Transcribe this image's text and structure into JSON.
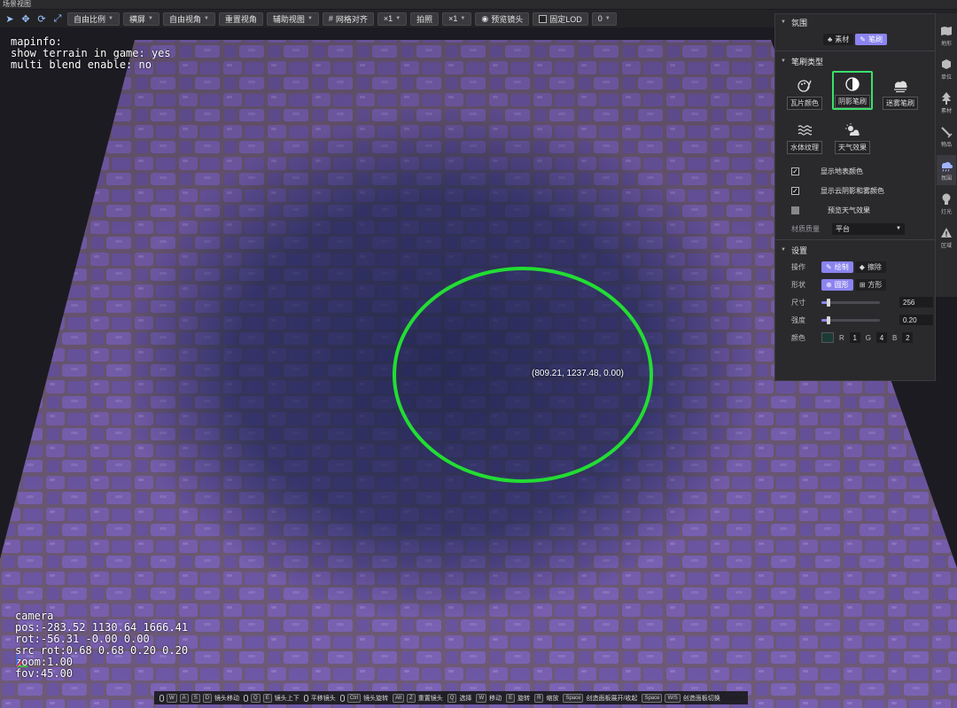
{
  "window": {
    "title": "场景视图"
  },
  "toolbar": {
    "buttons": [
      {
        "label": "自由比例",
        "dropdown": true
      },
      {
        "label": "横屏",
        "dropdown": true
      },
      {
        "label": "自由视角",
        "dropdown": true
      },
      {
        "label": "重置视角",
        "dropdown": false
      },
      {
        "label": "辅助视图",
        "dropdown": true
      },
      {
        "label": "网格对齐",
        "dropdown": false
      },
      {
        "label": "×1",
        "dropdown": true
      },
      {
        "label": "拍照",
        "dropdown": false
      },
      {
        "label": "×1",
        "dropdown": true
      },
      {
        "label": "预览镜头",
        "dropdown": false
      },
      {
        "label": "固定LOD",
        "dropdown": false
      },
      {
        "label": "0",
        "dropdown": true
      }
    ]
  },
  "viewport": {
    "mapinfo": {
      "line1": "mapinfo:",
      "line2": "show terrain in game: yes",
      "line3": "multi blend enable: no"
    },
    "camera": {
      "line1": "camera",
      "line2": "pos:-283.52 1130.64 1666.41",
      "line3": "rot:-56.31 -0.00 0.00",
      "line4": "src rot:0.68 0.68 0.20 0.20",
      "line5": "zoom:1.00",
      "line6": "fov:45.00"
    },
    "brush_position": "(809.21, 1237.48, 0.00)",
    "brush_color": "#22dd33"
  },
  "panel": {
    "range": {
      "title": "氛围",
      "options": [
        "素材",
        "笔刷"
      ],
      "active": "笔刷"
    },
    "brush_type": {
      "title": "笔刷类型",
      "items": [
        {
          "label": "瓦片颜色",
          "icon": "palette-brush-icon"
        },
        {
          "label": "阴影笔刷",
          "icon": "half-circle-icon",
          "selected": true
        },
        {
          "label": "迷雾笔刷",
          "icon": "fog-cloud-icon"
        },
        {
          "label": "水体纹理",
          "icon": "water-waves-icon"
        },
        {
          "label": "天气效果",
          "icon": "weather-sun-cloud-icon"
        }
      ]
    },
    "options": [
      {
        "label": "显示地表颜色",
        "checked": true
      },
      {
        "label": "显示云阴影和雾颜色",
        "checked": true
      },
      {
        "label": "预览天气效果",
        "checked": false
      }
    ],
    "material_quality": {
      "label": "材质质量",
      "value": "平台"
    },
    "settings": {
      "title": "设置",
      "operation": {
        "label": "操作",
        "options": [
          "绘制",
          "擦除"
        ],
        "active": "绘制"
      },
      "shape": {
        "label": "形状",
        "options": [
          "圆形",
          "方形"
        ],
        "active": "圆形"
      },
      "size": {
        "label": "尺寸",
        "value": "256",
        "fraction": 0.12
      },
      "strength": {
        "label": "强度",
        "value": "0.20",
        "fraction": 0.12
      },
      "color": {
        "label": "颜色",
        "swatch": "#1d3b36",
        "r_label": "R",
        "r": "1",
        "g_label": "G",
        "g": "4",
        "b_label": "B",
        "b": "2"
      }
    }
  },
  "sidebar": {
    "items": [
      {
        "label": "地形",
        "icon": "map-icon"
      },
      {
        "label": "单位",
        "icon": "cube-icon"
      },
      {
        "label": "素材",
        "icon": "tree-icon"
      },
      {
        "label": "物品",
        "icon": "sword-icon"
      },
      {
        "label": "氛围",
        "icon": "weather-icon",
        "active": true
      },
      {
        "label": "灯光",
        "icon": "bulb-icon"
      },
      {
        "label": "区域",
        "icon": "warning-icon"
      }
    ]
  },
  "hints": [
    {
      "keys": [
        "W",
        "A",
        "S",
        "D"
      ],
      "mouse": true,
      "label": "镜头移动"
    },
    {
      "keys": [
        "Q",
        "E"
      ],
      "mouse": true,
      "label": "镜头上下"
    },
    {
      "keys": [],
      "mouse": true,
      "label": "平移镜头"
    },
    {
      "keys": [
        "Ctrl"
      ],
      "mouse": true,
      "label": "镜头旋转"
    },
    {
      "keys": [
        "Alt",
        "Z"
      ],
      "mouse": false,
      "label": "重置镜头"
    },
    {
      "keys": [
        "Q"
      ],
      "mouse": false,
      "label": "选择"
    },
    {
      "keys": [
        "W"
      ],
      "mouse": false,
      "label": "移动"
    },
    {
      "keys": [
        "E"
      ],
      "mouse": false,
      "label": "旋转"
    },
    {
      "keys": [
        "R"
      ],
      "mouse": false,
      "label": "缩放"
    },
    {
      "keys": [
        "Space"
      ],
      "mouse": false,
      "label": "创造面板展开/收起"
    },
    {
      "keys": [
        "Space",
        "W/S"
      ],
      "mouse": false,
      "label": "创造面板切换"
    }
  ]
}
